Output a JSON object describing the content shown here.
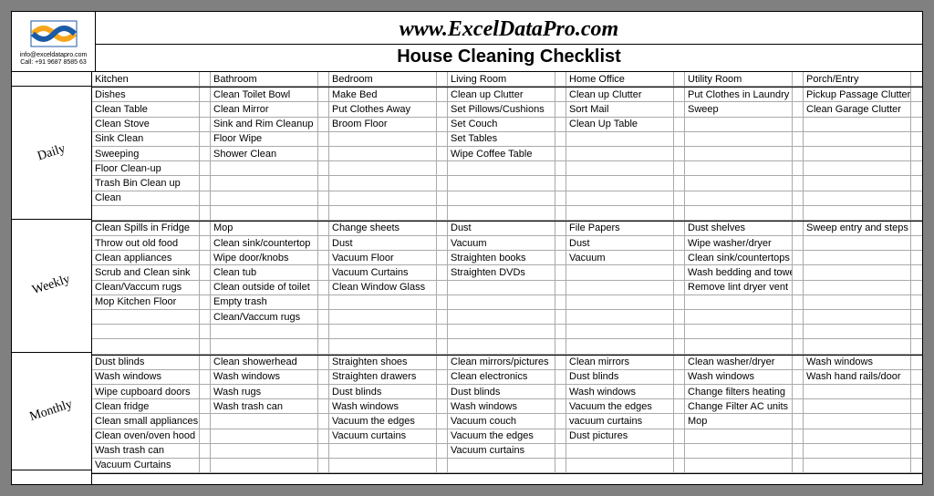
{
  "site_url": "www.ExcelDataPro.com",
  "doc_title": "House Cleaning Checklist",
  "contact_email": "info@exceldatapro.com",
  "contact_phone": "Call: +91 9687 8585 63",
  "columns": [
    "Kitchen",
    "Bathroom",
    "Bedroom",
    "Living Room",
    "Home Office",
    "Utility Room",
    "Porch/Entry"
  ],
  "sections": [
    {
      "freq": "Daily",
      "rows": [
        [
          "Dishes",
          "Clean Toilet Bowl",
          "Make Bed",
          "Clean up Clutter",
          "Clean up Clutter",
          "Put Clothes in Laundry",
          "Pickup Passage Clutter"
        ],
        [
          "Clean Table",
          "Clean Mirror",
          "Put Clothes Away",
          "Set Pillows/Cushions",
          "Sort Mail",
          "Sweep",
          "Clean Garage Clutter"
        ],
        [
          "Clean Stove",
          "Sink and Rim Cleanup",
          "Broom Floor",
          "Set Couch",
          "Clean Up Table",
          "",
          ""
        ],
        [
          "Sink Clean",
          "Floor Wipe",
          "",
          "Set Tables",
          "",
          "",
          ""
        ],
        [
          "Sweeping",
          "Shower Clean",
          "",
          "Wipe Coffee Table",
          "",
          "",
          ""
        ],
        [
          "Floor Clean-up",
          "",
          "",
          "",
          "",
          "",
          ""
        ],
        [
          "Trash Bin Clean up",
          "",
          "",
          "",
          "",
          "",
          ""
        ],
        [
          "Clean",
          "",
          "",
          "",
          "",
          "",
          ""
        ],
        [
          "",
          "",
          "",
          "",
          "",
          "",
          ""
        ]
      ]
    },
    {
      "freq": "Weekly",
      "rows": [
        [
          "Clean Spills in Fridge",
          "Mop",
          "Change sheets",
          "Dust",
          "File Papers",
          "Dust shelves",
          "Sweep entry and steps"
        ],
        [
          "Throw out old food",
          "Clean sink/countertop",
          "Dust",
          "Vacuum",
          "Dust",
          "Wipe washer/dryer",
          ""
        ],
        [
          "Clean appliances",
          "Wipe door/knobs",
          "Vacuum Floor",
          "Straighten books",
          "Vacuum",
          "Clean sink/countertops",
          ""
        ],
        [
          "Scrub and Clean sink",
          "Clean tub",
          "Vacuum Curtains",
          "Straighten DVDs",
          "",
          "Wash bedding and towels",
          ""
        ],
        [
          "Clean/Vaccum rugs",
          "Clean outside of toilet",
          "Clean Window Glass",
          "",
          "",
          "Remove lint dryer vent",
          ""
        ],
        [
          "Mop Kitchen Floor",
          "Empty trash",
          "",
          "",
          "",
          "",
          ""
        ],
        [
          "",
          "Clean/Vaccum rugs",
          "",
          "",
          "",
          "",
          ""
        ],
        [
          "",
          "",
          "",
          "",
          "",
          "",
          ""
        ],
        [
          "",
          "",
          "",
          "",
          "",
          "",
          ""
        ]
      ]
    },
    {
      "freq": "Monthly",
      "rows": [
        [
          "Dust blinds",
          "Clean showerhead",
          "Straighten shoes",
          "Clean mirrors/pictures",
          "Clean mirrors",
          "Clean washer/dryer",
          "Wash windows"
        ],
        [
          "Wash windows",
          "Wash windows",
          "Straighten drawers",
          "Clean electronics",
          "Dust blinds",
          "Wash windows",
          "Wash hand rails/door"
        ],
        [
          "Wipe cupboard doors",
          "Wash rugs",
          "Dust blinds",
          "Dust blinds",
          "Wash windows",
          "Change filters heating",
          ""
        ],
        [
          "Clean fridge",
          "Wash trash can",
          "Wash windows",
          "Wash windows",
          "Vacuum the edges",
          "Change Filter AC units",
          ""
        ],
        [
          "Clean small appliances",
          "",
          "Vacuum the edges",
          "Vacuum couch",
          "vacuum curtains",
          "Mop",
          ""
        ],
        [
          "Clean oven/oven hood",
          "",
          "Vacuum curtains",
          "Vacuum the edges",
          "Dust pictures",
          "",
          ""
        ],
        [
          "Wash trash can",
          "",
          "",
          "Vacuum curtains",
          "",
          "",
          ""
        ],
        [
          "Vacuum Curtains",
          "",
          "",
          "",
          "",
          "",
          ""
        ]
      ]
    }
  ]
}
